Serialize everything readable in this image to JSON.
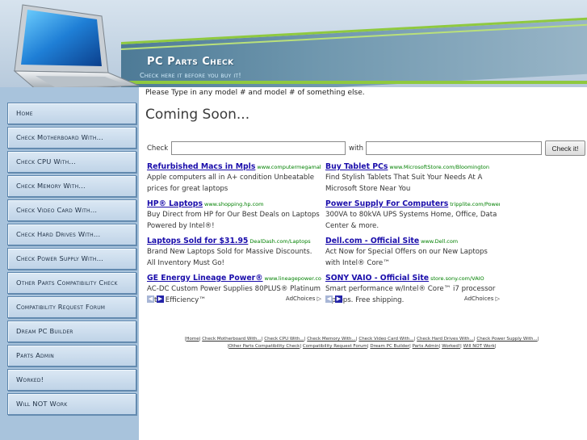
{
  "header": {
    "title": "PC Parts Check",
    "subtitle": "Check here it before you buy it!"
  },
  "sidebar": {
    "items": [
      {
        "label": "Home"
      },
      {
        "label": "Check Motherboard With..."
      },
      {
        "label": "Check CPU With..."
      },
      {
        "label": "Check Memory With..."
      },
      {
        "label": "Check Video Card With..."
      },
      {
        "label": "Check Hard Drives With..."
      },
      {
        "label": "Check Power Supply With..."
      },
      {
        "label": "Other Parts Compatibility Check"
      },
      {
        "label": "Compatibility Request Forum"
      },
      {
        "label": "Dream PC Builder"
      },
      {
        "label": "Parts Admin"
      },
      {
        "label": "Worked!"
      },
      {
        "label": "Will NOT Work"
      }
    ]
  },
  "main": {
    "instructions": "Please Type in any model # and model # of something else.",
    "heading": "Coming Soon...",
    "check_label": "Check",
    "with_label": "with",
    "input1_value": "",
    "input2_value": "",
    "button_label": "Check it!"
  },
  "ads": {
    "left": [
      {
        "title": "Refurbished Macs in Mpls",
        "url": "www.computermegamall.com",
        "body": "Apple computers all in A+ condition Unbeatable prices for great laptops"
      },
      {
        "title": "HP® Laptops",
        "url": "www.shopping.hp.com",
        "body": "Buy Direct from HP for Our Best Deals on Laptops Powered by Intel®!"
      },
      {
        "title": "Laptops Sold for $31.95",
        "url": "DealDash.com/Laptops",
        "body": "Brand New Laptops Sold for Massive Discounts. All Inventory Must Go!"
      },
      {
        "title": "GE Energy Lineage Power®",
        "url": "www.lineagepower.com/oem",
        "body": "AC-DC Custom Power Supplies 80PLUS® Platinum Total Efficiency™"
      }
    ],
    "right": [
      {
        "title": "Buy Tablet PCs",
        "url": "www.MicrosoftStore.com/Bloomington",
        "body": "Find Stylish Tablets That Suit Your Needs At A Microsoft Store Near You"
      },
      {
        "title": "Power Supply For Computers",
        "url": "tripplite.com/PowerProtects",
        "body": "300VA to 80kVA UPS Systems Home, Office, Data Center & more."
      },
      {
        "title": "Dell.com - Official Site",
        "url": "www.Dell.com",
        "body": "Act Now for Special Offers on our New Laptops with Intel® Core™"
      },
      {
        "title": "SONY VAIO - Official Site",
        "url": "store.sony.com/VAIO",
        "body": "Smart performance w/Intel® Core™ i7 processor laptops. Free shipping."
      }
    ],
    "adchoices_label": "AdChoices ▷",
    "prev_icon": "◀",
    "next_icon": "▶"
  },
  "footer": {
    "links": [
      "Home",
      "Check Motherboard With...",
      "Check CPU With...",
      "Check Memory With...",
      "Check Video Card With...",
      "Check Hard Drives With...",
      "Check Power Supply With...",
      "Other Parts Compatibility Check",
      "Compatibility Request Forum",
      "Dream PC Builder",
      "Parts Admin",
      "Worked!",
      "Will NOT Work"
    ]
  },
  "colors": {
    "sidebar_bg": "#a8c3dc",
    "nav_border": "#5d86ad",
    "ad_title": "#1a0dab",
    "ad_url": "#008000",
    "accent_green": "#8fc93f"
  }
}
